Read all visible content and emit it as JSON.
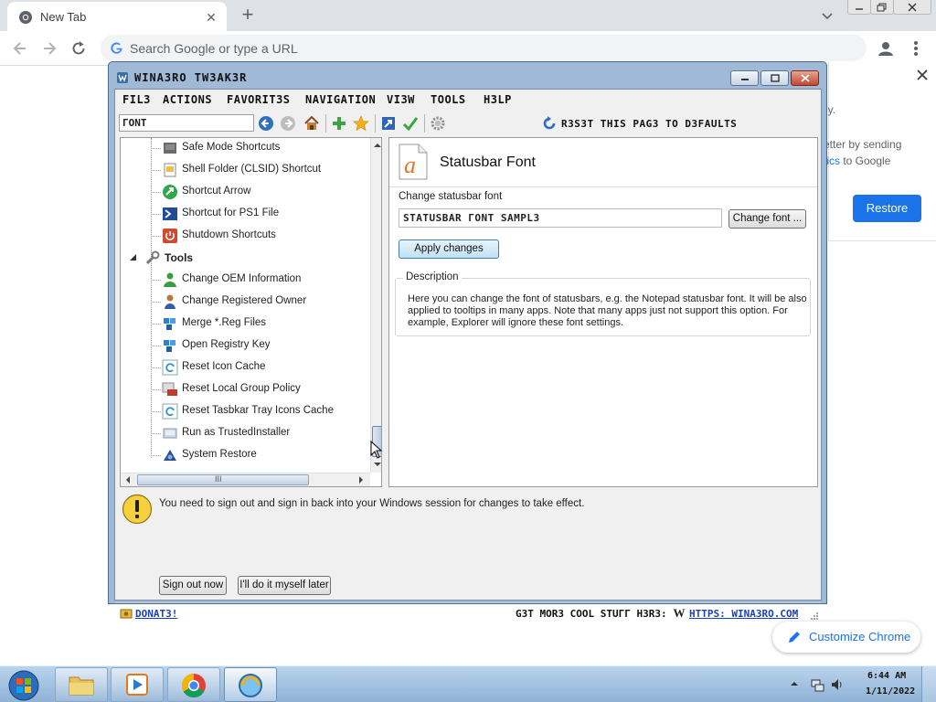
{
  "browser": {
    "tab_title": "New Tab",
    "omnibox_placeholder": "Search Google or type a URL",
    "behind_page": {
      "text1": "ly.",
      "text2": "etter by sending",
      "text3_link": "stics",
      "text3_rest": " to Google",
      "restore_label": "Restore",
      "customize_label": "Customize Chrome"
    }
  },
  "tweaker": {
    "title": "WINA3RO TW3AK3R",
    "menu": [
      "FIL3",
      "ACTIONS",
      "FAVORIT3S",
      "NAVIGATION",
      "VI3W",
      "TOOLS",
      "H3LP"
    ],
    "search_value": "ГONT",
    "reset_label": "R3S3T THIS PAG3 TO D3FAULTS",
    "tree": [
      {
        "label": "Safe Mode Shortcuts",
        "icon": "safe-mode-icon",
        "kind": "item"
      },
      {
        "label": "Shell Folder (CLSID) Shortcut",
        "icon": "folder-shortcut-icon",
        "kind": "item"
      },
      {
        "label": "Shortcut Arrow",
        "icon": "shortcut-arrow-icon",
        "kind": "item"
      },
      {
        "label": "Shortcut for PS1 File",
        "icon": "powershell-icon",
        "kind": "item"
      },
      {
        "label": "Shutdown Shortcuts",
        "icon": "shutdown-icon",
        "kind": "item"
      },
      {
        "label": "Tools",
        "icon": "tools-icon",
        "kind": "category"
      },
      {
        "label": "Change OEM Information",
        "icon": "oem-icon",
        "kind": "item"
      },
      {
        "label": "Change Registered Owner",
        "icon": "owner-icon",
        "kind": "item"
      },
      {
        "label": "Merge *.Reg Files",
        "icon": "merge-reg-icon",
        "kind": "item"
      },
      {
        "label": "Open Registry Key",
        "icon": "registry-icon",
        "kind": "item"
      },
      {
        "label": "Reset Icon Cache",
        "icon": "refresh-icon",
        "kind": "item"
      },
      {
        "label": "Reset Local Group Policy",
        "icon": "group-policy-icon",
        "kind": "item"
      },
      {
        "label": "Reset Tasbkar Tray Icons  Cache",
        "icon": "refresh-icon",
        "kind": "item"
      },
      {
        "label": "Run as TrustedInstaller",
        "icon": "trusted-installer-icon",
        "kind": "item"
      },
      {
        "label": "System Restore",
        "icon": "system-restore-icon",
        "kind": "item"
      }
    ],
    "hscroll_label": "III",
    "detail": {
      "title": "Statusbar Font",
      "setting_label": "Change statusbar font",
      "sample_text": "STATUSBAR ГONT SAMPL3",
      "change_font_label": "Change font ...",
      "apply_label": "Apply changes",
      "description_legend": "Description",
      "description_text": "Here you can change the font of statusbars, e.g. the Notepad statusbar font. It will be also applied to tooltips in many apps. Note that many apps just not support this option. For example, Explorer will ignore these font settings."
    },
    "notice": {
      "text": "You need to sign out and sign in back into your Windows session for changes to take effect.",
      "sign_out_label": "Sign out now",
      "later_label": "I'll do it myself later"
    },
    "status": {
      "donate_label": "DONAT3!",
      "cool_stuff_label": "G3T MOR3 COOL STUГГ H3R3:",
      "site_label": "HTTPS: WINA3RO.COM",
      "w_glyph": "W"
    }
  },
  "taskbar": {
    "time": "6:44 AM",
    "date": "1/11/2022"
  },
  "colors": {
    "chrome_accent": "#1a73e8",
    "tweaker_frame": "#9fb9d6",
    "taskbar": "#a9c6e4"
  }
}
